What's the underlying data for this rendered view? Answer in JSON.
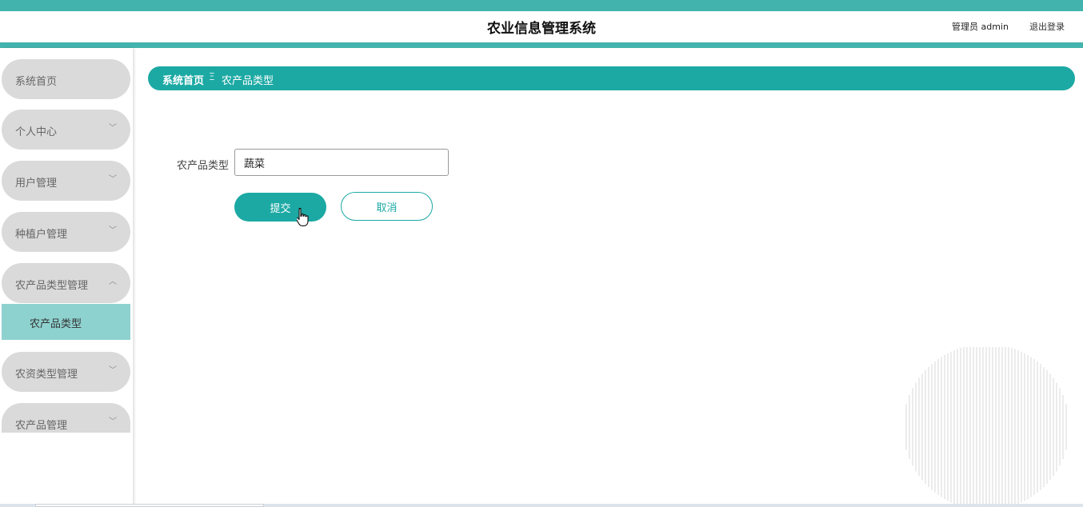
{
  "header": {
    "title": "农业信息管理系统",
    "user": "管理员 admin",
    "logout": "退出登录"
  },
  "sidebar": {
    "items": [
      {
        "label": "系统首页",
        "chevron": ""
      },
      {
        "label": "个人中心",
        "chevron": "﹀"
      },
      {
        "label": "用户管理",
        "chevron": "﹀"
      },
      {
        "label": "种植户管理",
        "chevron": "﹀"
      },
      {
        "label": "农产品类型管理",
        "chevron": "︿"
      },
      {
        "label": "农资类型管理",
        "chevron": "﹀"
      },
      {
        "label": "农产品管理",
        "chevron": "﹀"
      }
    ],
    "active_sub": "农产品类型"
  },
  "breadcrumb": {
    "home": "系统首页",
    "separator": "Ξ",
    "current": "农产品类型"
  },
  "form": {
    "field_label": "农产品类型",
    "field_value": "蔬菜",
    "submit": "提交",
    "cancel": "取消"
  },
  "colors": {
    "accent": "#1ca9a4",
    "header_band": "#43b3ad",
    "submenu_active": "#8ed2d0",
    "menu_bg": "#dadada"
  }
}
